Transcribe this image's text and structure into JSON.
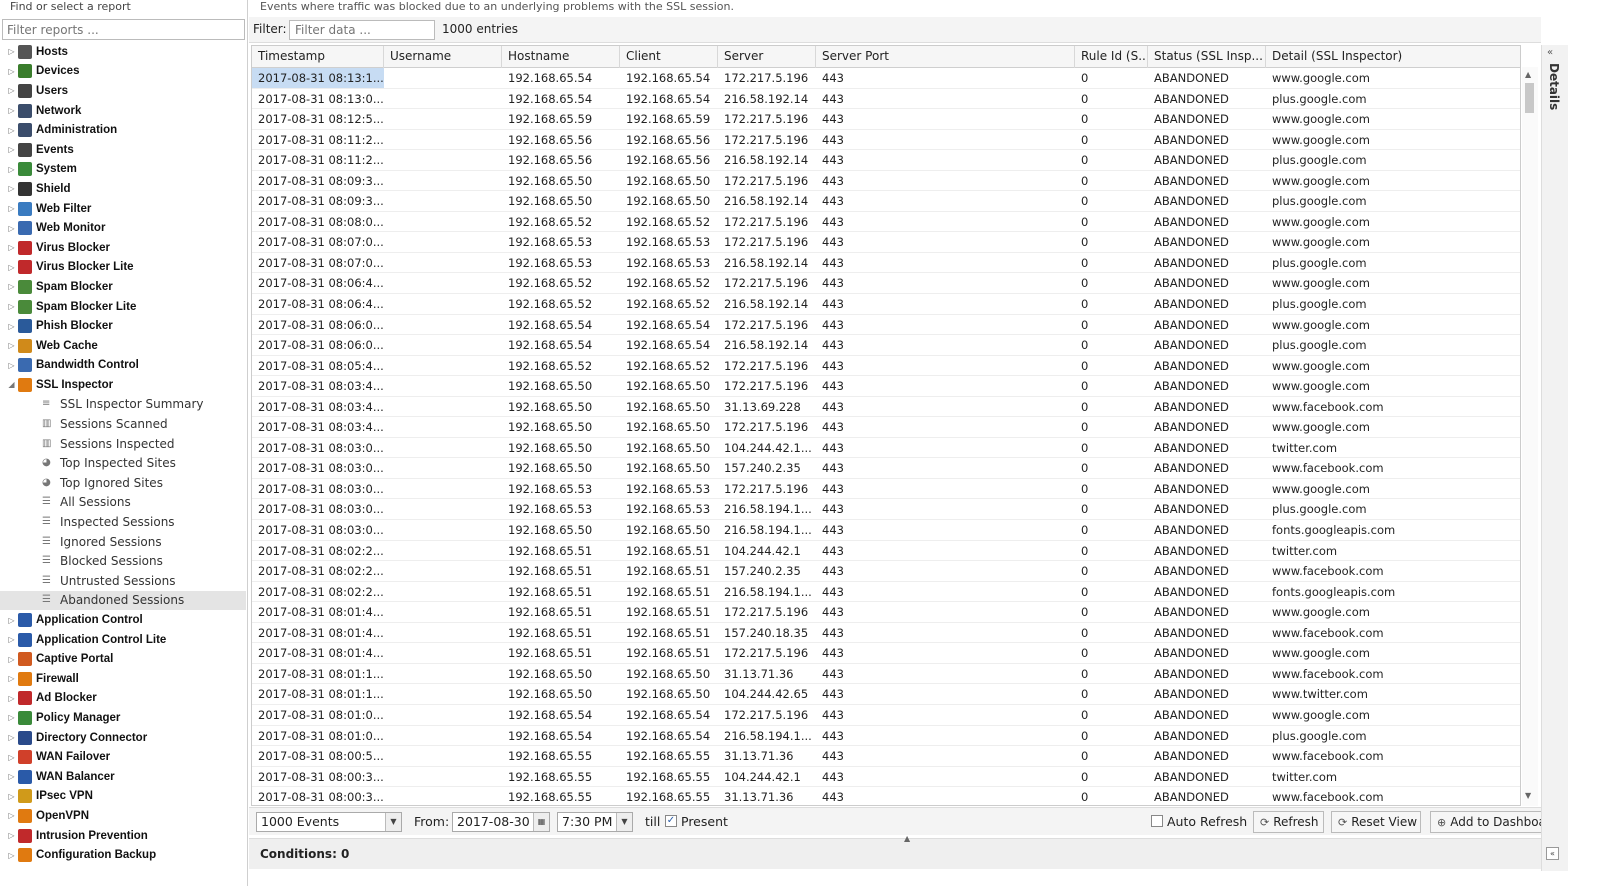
{
  "sidebar": {
    "title": "Find or select a report",
    "filter_placeholder": "Filter reports ...",
    "items": [
      {
        "label": "Hosts",
        "icon": "hosts-icon",
        "color": "#555"
      },
      {
        "label": "Devices",
        "icon": "devices-icon",
        "color": "#3a7d2c"
      },
      {
        "label": "Users",
        "icon": "users-icon",
        "color": "#444"
      },
      {
        "label": "Network",
        "icon": "network-icon",
        "color": "#3b4d6b"
      },
      {
        "label": "Administration",
        "icon": "administration-icon",
        "color": "#3b4d6b"
      },
      {
        "label": "Events",
        "icon": "events-icon",
        "color": "#444"
      },
      {
        "label": "System",
        "icon": "system-icon",
        "color": "#3a8a3a"
      },
      {
        "label": "Shield",
        "icon": "shield-icon",
        "color": "#333"
      },
      {
        "label": "Web Filter",
        "icon": "web-filter-icon",
        "color": "#3a7bc0"
      },
      {
        "label": "Web Monitor",
        "icon": "web-monitor-icon",
        "color": "#3a6ab0"
      },
      {
        "label": "Virus Blocker",
        "icon": "virus-blocker-icon",
        "color": "#c0292b"
      },
      {
        "label": "Virus Blocker Lite",
        "icon": "virus-blocker-lite-icon",
        "color": "#c0292b"
      },
      {
        "label": "Spam Blocker",
        "icon": "spam-blocker-icon",
        "color": "#4a8a3a"
      },
      {
        "label": "Spam Blocker Lite",
        "icon": "spam-blocker-lite-icon",
        "color": "#4a8a3a"
      },
      {
        "label": "Phish Blocker",
        "icon": "phish-blocker-icon",
        "color": "#2a5a9a"
      },
      {
        "label": "Web Cache",
        "icon": "web-cache-icon",
        "color": "#d08a1a"
      },
      {
        "label": "Bandwidth Control",
        "icon": "bandwidth-control-icon",
        "color": "#3a6ab0"
      },
      {
        "label": "SSL Inspector",
        "icon": "ssl-inspector-icon",
        "color": "#e07a10",
        "expanded": true,
        "children": [
          {
            "label": "SSL Inspector Summary",
            "icon": "text-icon"
          },
          {
            "label": "Sessions Scanned",
            "icon": "bar-chart-icon"
          },
          {
            "label": "Sessions Inspected",
            "icon": "bar-chart-icon"
          },
          {
            "label": "Top Inspected Sites",
            "icon": "pie-chart-icon"
          },
          {
            "label": "Top Ignored Sites",
            "icon": "pie-chart-icon"
          },
          {
            "label": "All Sessions",
            "icon": "list-icon"
          },
          {
            "label": "Inspected Sessions",
            "icon": "list-icon"
          },
          {
            "label": "Ignored Sessions",
            "icon": "list-icon"
          },
          {
            "label": "Blocked Sessions",
            "icon": "list-icon"
          },
          {
            "label": "Untrusted Sessions",
            "icon": "list-icon"
          },
          {
            "label": "Abandoned Sessions",
            "icon": "list-icon",
            "selected": true
          }
        ]
      },
      {
        "label": "Application Control",
        "icon": "application-control-icon",
        "color": "#2a5aa8"
      },
      {
        "label": "Application Control Lite",
        "icon": "application-control-lite-icon",
        "color": "#2a5aa8"
      },
      {
        "label": "Captive Portal",
        "icon": "captive-portal-icon",
        "color": "#d05a20"
      },
      {
        "label": "Firewall",
        "icon": "firewall-icon",
        "color": "#e07a10"
      },
      {
        "label": "Ad Blocker",
        "icon": "ad-blocker-icon",
        "color": "#c0292b"
      },
      {
        "label": "Policy Manager",
        "icon": "policy-manager-icon",
        "color": "#3a8a3a"
      },
      {
        "label": "Directory Connector",
        "icon": "directory-connector-icon",
        "color": "#2a4a8a"
      },
      {
        "label": "WAN Failover",
        "icon": "wan-failover-icon",
        "color": "#d0402a"
      },
      {
        "label": "WAN Balancer",
        "icon": "wan-balancer-icon",
        "color": "#2a5aa8"
      },
      {
        "label": "IPsec VPN",
        "icon": "ipsec-vpn-icon",
        "color": "#d09a1a"
      },
      {
        "label": "OpenVPN",
        "icon": "openvpn-icon",
        "color": "#e07a10"
      },
      {
        "label": "Intrusion Prevention",
        "icon": "intrusion-prevention-icon",
        "color": "#c0292b"
      },
      {
        "label": "Configuration Backup",
        "icon": "configuration-backup-icon",
        "color": "#e07a10"
      }
    ]
  },
  "main": {
    "description": "Events where traffic was blocked due to an underlying problems with the SSL session.",
    "filter_label": "Filter:",
    "filter_placeholder": "Filter data ...",
    "entries": "1000 entries",
    "columns": [
      "Timestamp",
      "Username",
      "Hostname",
      "Client",
      "Server",
      "Server Port",
      "Rule Id (S...",
      "Status (SSL Insp...",
      "Detail (SSL Inspector)"
    ],
    "rows": [
      [
        "2017-08-31 08:13:1...",
        "",
        "192.168.65.54",
        "192.168.65.54",
        "172.217.5.196",
        "443",
        "0",
        "ABANDONED",
        "www.google.com"
      ],
      [
        "2017-08-31 08:13:0...",
        "",
        "192.168.65.54",
        "192.168.65.54",
        "216.58.192.14",
        "443",
        "0",
        "ABANDONED",
        "plus.google.com"
      ],
      [
        "2017-08-31 08:12:5...",
        "",
        "192.168.65.59",
        "192.168.65.59",
        "172.217.5.196",
        "443",
        "0",
        "ABANDONED",
        "www.google.com"
      ],
      [
        "2017-08-31 08:11:2...",
        "",
        "192.168.65.56",
        "192.168.65.56",
        "172.217.5.196",
        "443",
        "0",
        "ABANDONED",
        "www.google.com"
      ],
      [
        "2017-08-31 08:11:2...",
        "",
        "192.168.65.56",
        "192.168.65.56",
        "216.58.192.14",
        "443",
        "0",
        "ABANDONED",
        "plus.google.com"
      ],
      [
        "2017-08-31 08:09:3...",
        "",
        "192.168.65.50",
        "192.168.65.50",
        "172.217.5.196",
        "443",
        "0",
        "ABANDONED",
        "www.google.com"
      ],
      [
        "2017-08-31 08:09:3...",
        "",
        "192.168.65.50",
        "192.168.65.50",
        "216.58.192.14",
        "443",
        "0",
        "ABANDONED",
        "plus.google.com"
      ],
      [
        "2017-08-31 08:08:0...",
        "",
        "192.168.65.52",
        "192.168.65.52",
        "172.217.5.196",
        "443",
        "0",
        "ABANDONED",
        "www.google.com"
      ],
      [
        "2017-08-31 08:07:0...",
        "",
        "192.168.65.53",
        "192.168.65.53",
        "172.217.5.196",
        "443",
        "0",
        "ABANDONED",
        "www.google.com"
      ],
      [
        "2017-08-31 08:07:0...",
        "",
        "192.168.65.53",
        "192.168.65.53",
        "216.58.192.14",
        "443",
        "0",
        "ABANDONED",
        "plus.google.com"
      ],
      [
        "2017-08-31 08:06:4...",
        "",
        "192.168.65.52",
        "192.168.65.52",
        "172.217.5.196",
        "443",
        "0",
        "ABANDONED",
        "www.google.com"
      ],
      [
        "2017-08-31 08:06:4...",
        "",
        "192.168.65.52",
        "192.168.65.52",
        "216.58.192.14",
        "443",
        "0",
        "ABANDONED",
        "plus.google.com"
      ],
      [
        "2017-08-31 08:06:0...",
        "",
        "192.168.65.54",
        "192.168.65.54",
        "172.217.5.196",
        "443",
        "0",
        "ABANDONED",
        "www.google.com"
      ],
      [
        "2017-08-31 08:06:0...",
        "",
        "192.168.65.54",
        "192.168.65.54",
        "216.58.192.14",
        "443",
        "0",
        "ABANDONED",
        "plus.google.com"
      ],
      [
        "2017-08-31 08:05:4...",
        "",
        "192.168.65.52",
        "192.168.65.52",
        "172.217.5.196",
        "443",
        "0",
        "ABANDONED",
        "www.google.com"
      ],
      [
        "2017-08-31 08:03:4...",
        "",
        "192.168.65.50",
        "192.168.65.50",
        "172.217.5.196",
        "443",
        "0",
        "ABANDONED",
        "www.google.com"
      ],
      [
        "2017-08-31 08:03:4...",
        "",
        "192.168.65.50",
        "192.168.65.50",
        "31.13.69.228",
        "443",
        "0",
        "ABANDONED",
        "www.facebook.com"
      ],
      [
        "2017-08-31 08:03:4...",
        "",
        "192.168.65.50",
        "192.168.65.50",
        "172.217.5.196",
        "443",
        "0",
        "ABANDONED",
        "www.google.com"
      ],
      [
        "2017-08-31 08:03:0...",
        "",
        "192.168.65.50",
        "192.168.65.50",
        "104.244.42.1...",
        "443",
        "0",
        "ABANDONED",
        "twitter.com"
      ],
      [
        "2017-08-31 08:03:0...",
        "",
        "192.168.65.50",
        "192.168.65.50",
        "157.240.2.35",
        "443",
        "0",
        "ABANDONED",
        "www.facebook.com"
      ],
      [
        "2017-08-31 08:03:0...",
        "",
        "192.168.65.53",
        "192.168.65.53",
        "172.217.5.196",
        "443",
        "0",
        "ABANDONED",
        "www.google.com"
      ],
      [
        "2017-08-31 08:03:0...",
        "",
        "192.168.65.53",
        "192.168.65.53",
        "216.58.194.1...",
        "443",
        "0",
        "ABANDONED",
        "plus.google.com"
      ],
      [
        "2017-08-31 08:03:0...",
        "",
        "192.168.65.50",
        "192.168.65.50",
        "216.58.194.1...",
        "443",
        "0",
        "ABANDONED",
        "fonts.googleapis.com"
      ],
      [
        "2017-08-31 08:02:2...",
        "",
        "192.168.65.51",
        "192.168.65.51",
        "104.244.42.1",
        "443",
        "0",
        "ABANDONED",
        "twitter.com"
      ],
      [
        "2017-08-31 08:02:2...",
        "",
        "192.168.65.51",
        "192.168.65.51",
        "157.240.2.35",
        "443",
        "0",
        "ABANDONED",
        "www.facebook.com"
      ],
      [
        "2017-08-31 08:02:2...",
        "",
        "192.168.65.51",
        "192.168.65.51",
        "216.58.194.1...",
        "443",
        "0",
        "ABANDONED",
        "fonts.googleapis.com"
      ],
      [
        "2017-08-31 08:01:4...",
        "",
        "192.168.65.51",
        "192.168.65.51",
        "172.217.5.196",
        "443",
        "0",
        "ABANDONED",
        "www.google.com"
      ],
      [
        "2017-08-31 08:01:4...",
        "",
        "192.168.65.51",
        "192.168.65.51",
        "157.240.18.35",
        "443",
        "0",
        "ABANDONED",
        "www.facebook.com"
      ],
      [
        "2017-08-31 08:01:4...",
        "",
        "192.168.65.51",
        "192.168.65.51",
        "172.217.5.196",
        "443",
        "0",
        "ABANDONED",
        "www.google.com"
      ],
      [
        "2017-08-31 08:01:1...",
        "",
        "192.168.65.50",
        "192.168.65.50",
        "31.13.71.36",
        "443",
        "0",
        "ABANDONED",
        "www.facebook.com"
      ],
      [
        "2017-08-31 08:01:1...",
        "",
        "192.168.65.50",
        "192.168.65.50",
        "104.244.42.65",
        "443",
        "0",
        "ABANDONED",
        "www.twitter.com"
      ],
      [
        "2017-08-31 08:01:0...",
        "",
        "192.168.65.54",
        "192.168.65.54",
        "172.217.5.196",
        "443",
        "0",
        "ABANDONED",
        "www.google.com"
      ],
      [
        "2017-08-31 08:01:0...",
        "",
        "192.168.65.54",
        "192.168.65.54",
        "216.58.194.1...",
        "443",
        "0",
        "ABANDONED",
        "plus.google.com"
      ],
      [
        "2017-08-31 08:00:5...",
        "",
        "192.168.65.55",
        "192.168.65.55",
        "31.13.71.36",
        "443",
        "0",
        "ABANDONED",
        "www.facebook.com"
      ],
      [
        "2017-08-31 08:00:3...",
        "",
        "192.168.65.55",
        "192.168.65.55",
        "104.244.42.1",
        "443",
        "0",
        "ABANDONED",
        "twitter.com"
      ],
      [
        "2017-08-31 08:00:3...",
        "",
        "192.168.65.55",
        "192.168.65.55",
        "31.13.71.36",
        "443",
        "0",
        "ABANDONED",
        "www.facebook.com"
      ]
    ]
  },
  "bottom": {
    "limit_value": "1000 Events",
    "from_label": "From:",
    "from_date": "2017-08-30",
    "from_time": "7:30 PM",
    "till_label": "till",
    "present_label": "Present",
    "present_checked": true,
    "auto_refresh_label": "Auto Refresh",
    "auto_refresh_checked": false,
    "refresh_label": "Refresh",
    "reset_view_label": "Reset View",
    "add_dashboard_label": "Add to Dashboard"
  },
  "conditions": {
    "label": "Conditions: 0"
  },
  "details": {
    "label": "Details"
  },
  "colors": {
    "selection": "#c7dcf3",
    "sidebar_selected": "#e4e4e4"
  }
}
